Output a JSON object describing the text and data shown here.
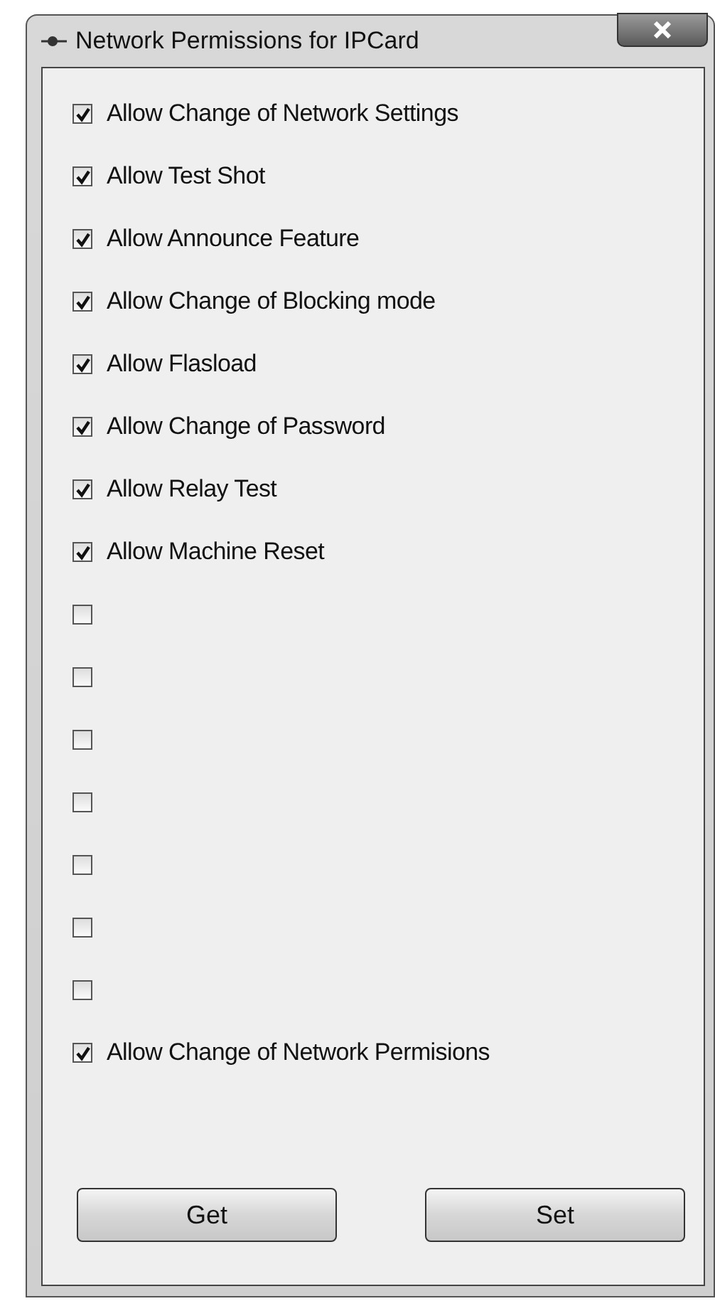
{
  "window": {
    "title": "Network Permissions for IPCard"
  },
  "permissions": [
    {
      "label": "Allow Change of Network Settings",
      "checked": true
    },
    {
      "label": "Allow Test Shot",
      "checked": true
    },
    {
      "label": "Allow Announce Feature",
      "checked": true
    },
    {
      "label": "Allow Change of Blocking mode",
      "checked": true
    },
    {
      "label": "Allow Flasload",
      "checked": true
    },
    {
      "label": "Allow Change of Password",
      "checked": true
    },
    {
      "label": "Allow Relay Test",
      "checked": true
    },
    {
      "label": "Allow Machine Reset",
      "checked": true
    },
    {
      "checked": false
    },
    {
      "checked": false
    },
    {
      "checked": false
    },
    {
      "checked": false
    },
    {
      "checked": false
    },
    {
      "checked": false
    },
    {
      "checked": false
    },
    {
      "label": "Allow Change of Network Permisions",
      "checked": true
    }
  ],
  "buttons": [
    "Get",
    "Set"
  ]
}
